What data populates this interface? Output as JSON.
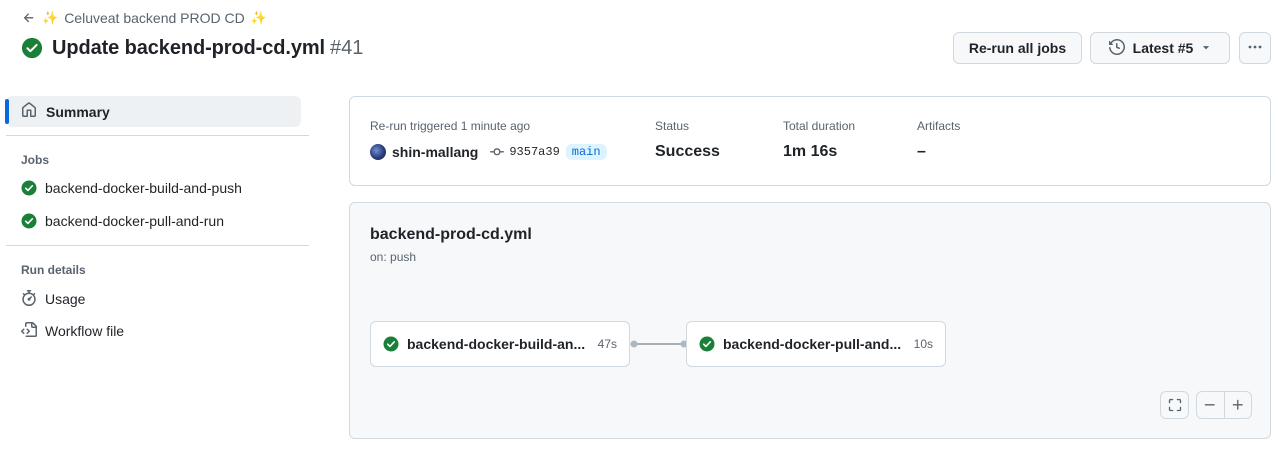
{
  "header": {
    "breadcrumb_text": "Celuveat backend PROD CD",
    "title": "Update backend-prod-cd.yml",
    "run_number": "#41",
    "rerun_label": "Re-run all jobs",
    "latest_label": "Latest #5"
  },
  "sidebar": {
    "summary_label": "Summary",
    "jobs_heading": "Jobs",
    "jobs": [
      {
        "label": "backend-docker-build-and-push"
      },
      {
        "label": "backend-docker-pull-and-run"
      }
    ],
    "run_details_heading": "Run details",
    "usage_label": "Usage",
    "workflow_file_label": "Workflow file"
  },
  "summary": {
    "trigger_label": "Re-run triggered 1 minute ago",
    "user": "shin-mallang",
    "commit_sha": "9357a39",
    "branch": "main",
    "status_label": "Status",
    "status_value": "Success",
    "duration_label": "Total duration",
    "duration_value": "1m 16s",
    "artifacts_label": "Artifacts",
    "artifacts_value": "–"
  },
  "graph": {
    "workflow_file": "backend-prod-cd.yml",
    "trigger": "on: push",
    "jobs": [
      {
        "label": "backend-docker-build-an...",
        "duration": "47s"
      },
      {
        "label": "backend-docker-pull-and...",
        "duration": "10s"
      }
    ]
  },
  "colors": {
    "success": "#1a7f37",
    "accent": "#0969da",
    "muted": "#59636e",
    "border": "#d1d9e0"
  }
}
